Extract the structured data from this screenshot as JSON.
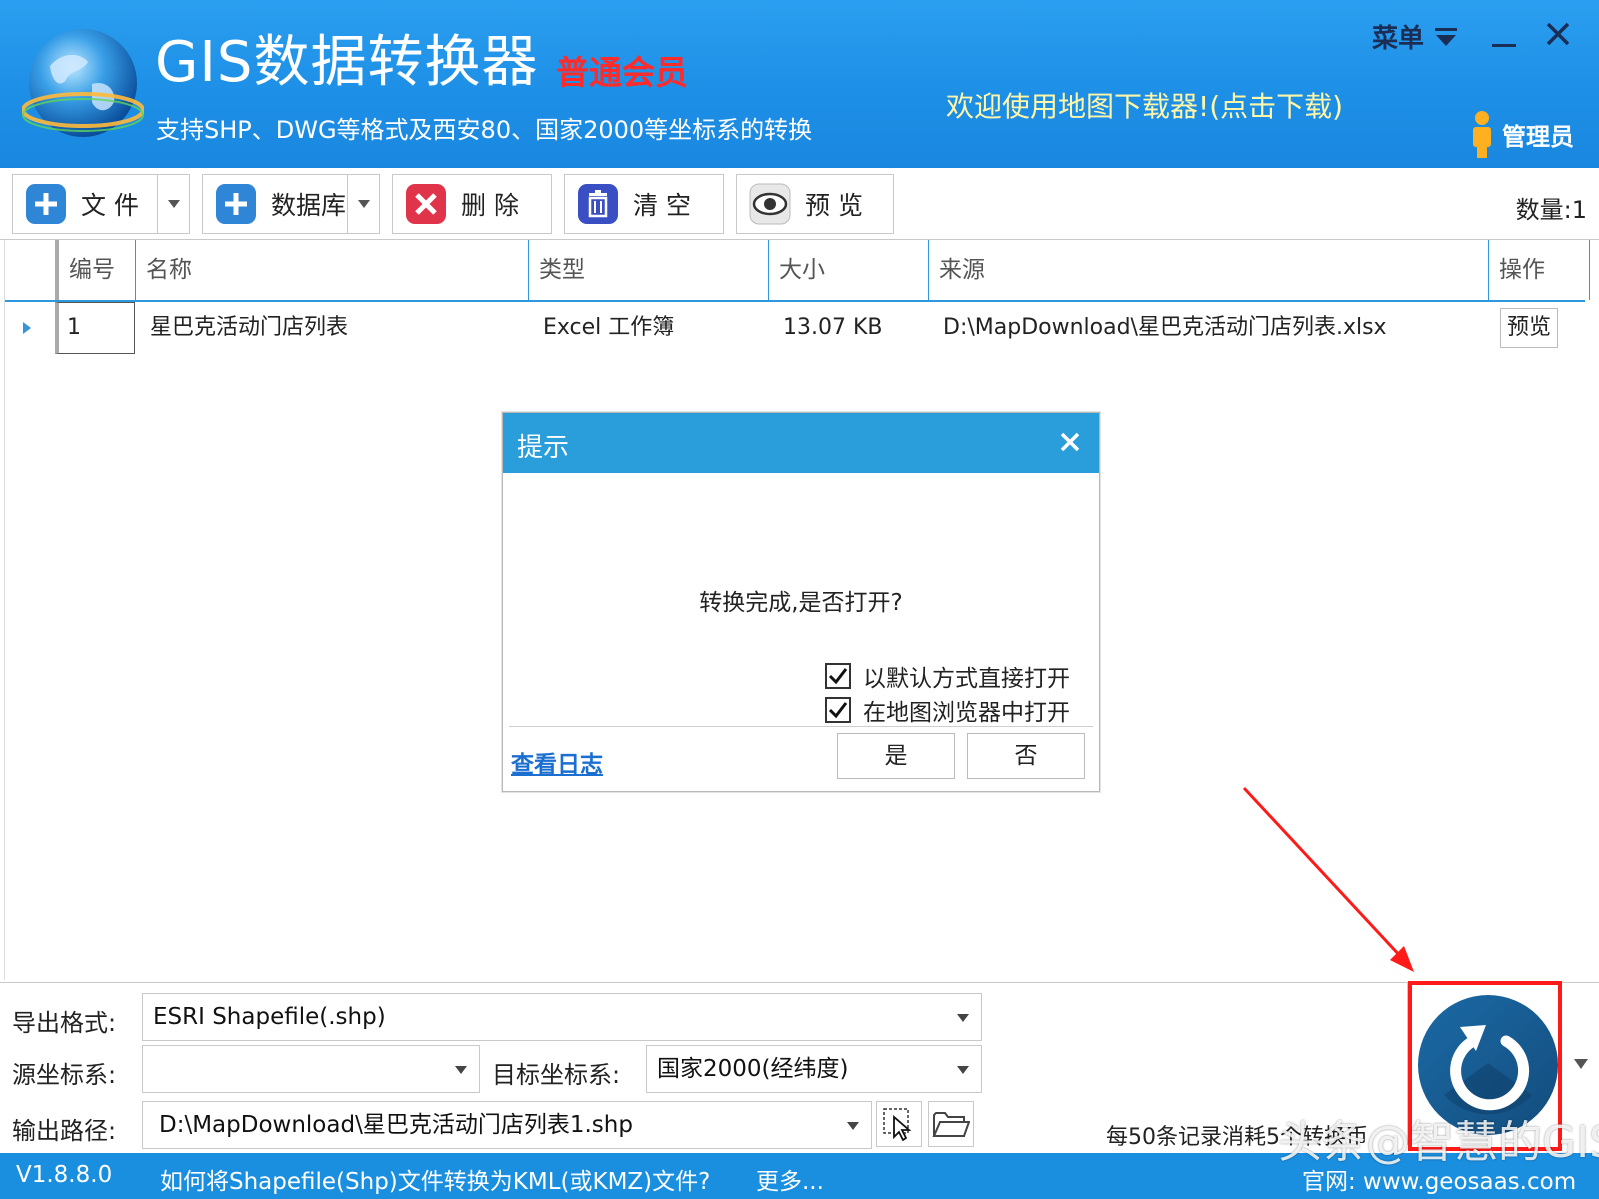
{
  "header": {
    "app_title": "GIS数据转换器",
    "member_badge": "普通会员",
    "subtitle": "支持SHP、DWG等格式及西安80、国家2000等坐标系的转换",
    "promo_link": "欢迎使用地图下载器!(点击下载)",
    "menu_label": "菜单",
    "admin_label": "管理员",
    "logo_icon": "globe-logo-icon"
  },
  "toolbar": {
    "file_label": "文 件",
    "database_label": "数据库",
    "delete_label": "删 除",
    "clear_label": "清 空",
    "preview_label": "预 览",
    "count_label": "数量:1"
  },
  "grid": {
    "columns": [
      "编号",
      "名称",
      "类型",
      "大小",
      "来源",
      "操作"
    ],
    "rows": [
      {
        "index": "1",
        "name": "星巴克活动门店列表",
        "type": "Excel 工作簿",
        "size": "13.07 KB",
        "source": "D:\\MapDownload\\星巴克活动门店列表.xlsx",
        "action": "预览"
      }
    ]
  },
  "dialog": {
    "title": "提示",
    "message": "转换完成,是否打开?",
    "option_default_open": "以默认方式直接打开",
    "option_default_open_checked": true,
    "option_map_browser": "在地图浏览器中打开",
    "option_map_browser_checked": true,
    "view_log": "查看日志",
    "yes_label": "是",
    "no_label": "否"
  },
  "settings": {
    "export_format_label": "导出格式:",
    "export_format_value": "ESRI Shapefile(.shp)",
    "source_crs_label": "源坐标系:",
    "source_crs_value": "",
    "target_crs_label": "目标坐标系:",
    "target_crs_value": "国家2000(经纬度)",
    "output_path_label": "输出路径:",
    "output_path_value": "D:\\MapDownload\\星巴克活动门店列表1.shp",
    "cost_note": "每50条记录消耗5个转换币"
  },
  "status_bar": {
    "version": "V1.8.8.0",
    "tip_link": "如何将Shapefile(Shp)文件转换为KML(或KMZ)文件?",
    "more_link": "更多...",
    "website": "官网: www.geosaas.com"
  },
  "watermark": "头条@智慧的GIS",
  "colors": {
    "header_blue": "#1d8fe6",
    "dialog_title_blue": "#2a9ddb",
    "member_red": "#ff2a2a",
    "promo_yellow": "#fff6a8",
    "highlight_red": "#ff1a1a",
    "convert_button_blue": "#1a5f94"
  }
}
